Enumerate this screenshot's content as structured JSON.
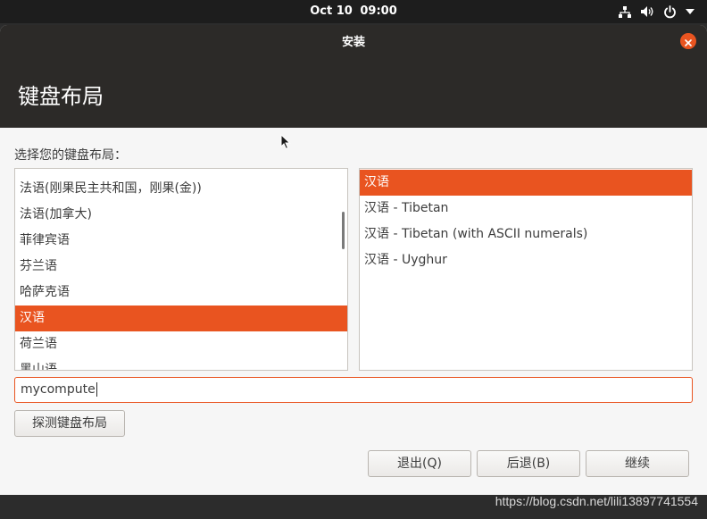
{
  "topbar": {
    "date": "Oct 10",
    "time": "09:00",
    "icons": [
      "network-icon",
      "volume-icon",
      "power-icon",
      "menu-arrow-icon"
    ]
  },
  "window": {
    "title": "安装",
    "page_title": "键盘布局",
    "prompt": "选择您的键盘布局：",
    "layouts": [
      "法语(刚果民主共和国，刚果(金))",
      "法语(加拿大)",
      "菲律宾语",
      "芬兰语",
      "哈萨克语",
      "汉语",
      "荷兰语",
      "黑山语"
    ],
    "variants": [
      "汉语",
      "汉语 - Tibetan",
      "汉语 - Tibetan (with ASCII numerals)",
      "汉语 - Uyghur"
    ],
    "test_input_value": "mycompute",
    "buttons": {
      "detect": "探测键盘布局",
      "quit": "退出(Q)",
      "back": "后退(B)",
      "continue": "继续"
    }
  },
  "colors": {
    "accent": "#e95420",
    "header_bg": "#2c2a28",
    "topbar_bg": "#1d1d1d"
  },
  "watermark": "https://blog.csdn.net/lili13897741554"
}
